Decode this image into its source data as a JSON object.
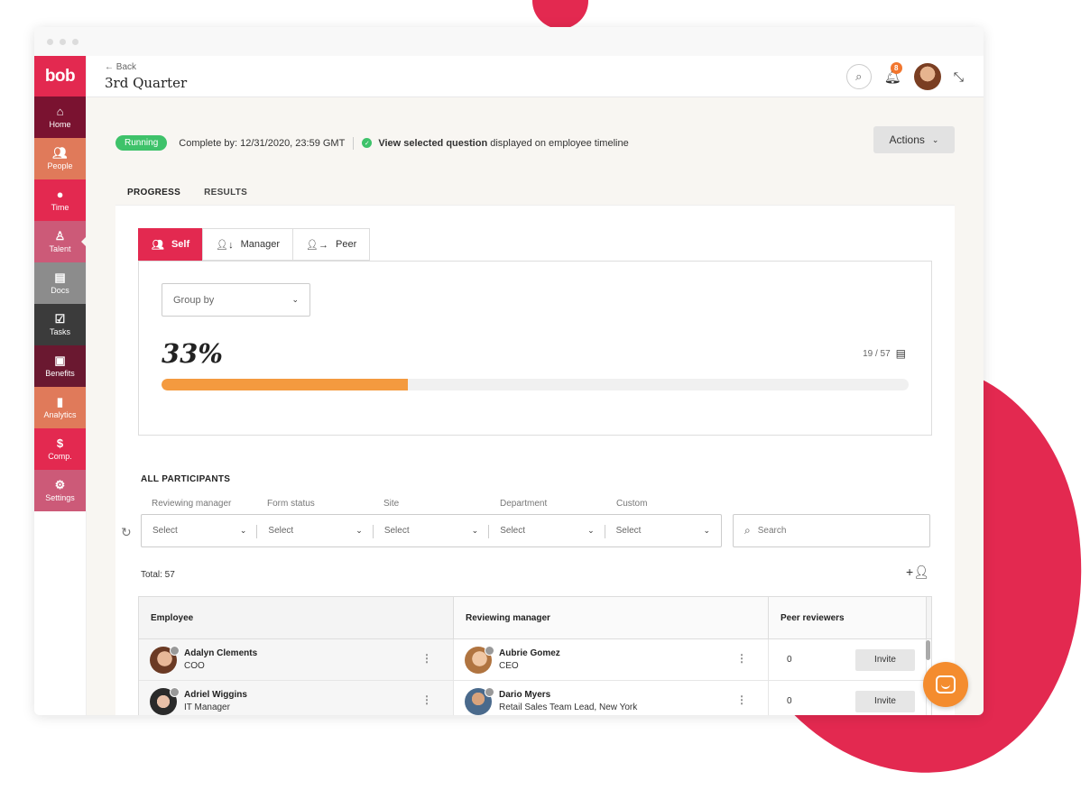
{
  "app": {
    "logo": "bob",
    "brand_color": "#e32950"
  },
  "sidebar": {
    "items": [
      {
        "label": "Home",
        "icon": "home-icon",
        "color": "#7a1230"
      },
      {
        "label": "People",
        "icon": "people-icon",
        "color": "#e07a5a"
      },
      {
        "label": "Time",
        "icon": "clock-icon",
        "color": "#e32950"
      },
      {
        "label": "Talent",
        "icon": "talent-icon",
        "color": "#cc5a78",
        "active": true
      },
      {
        "label": "Docs",
        "icon": "docs-icon",
        "color": "#8c8c8c"
      },
      {
        "label": "Tasks",
        "icon": "tasks-icon",
        "color": "#3b3b3b"
      },
      {
        "label": "Benefits",
        "icon": "gift-icon",
        "color": "#6a1830"
      },
      {
        "label": "Analytics",
        "icon": "analytics-icon",
        "color": "#e07a5a"
      },
      {
        "label": "Comp.",
        "icon": "dollar-icon",
        "color": "#e32950"
      },
      {
        "label": "Settings",
        "icon": "gear-icon",
        "color": "#cc5a78"
      }
    ]
  },
  "header": {
    "back_label": "← Back",
    "title": "3rd Quarter",
    "notification_count": "8"
  },
  "status": {
    "badge": "Running",
    "complete_by": "Complete by: 12/31/2020, 23:59 GMT",
    "view_selected": "View selected question",
    "timeline_text": " displayed on employee timeline",
    "actions_label": "Actions"
  },
  "tabs": [
    "PROGRESS",
    "RESULTS"
  ],
  "subtabs": [
    {
      "label": "Self",
      "icon": "people-icon"
    },
    {
      "label": "Manager",
      "icon": "manager-icon"
    },
    {
      "label": "Peer",
      "icon": "peer-icon"
    }
  ],
  "progress": {
    "group_by_placeholder": "Group by",
    "percent_label": "33%",
    "count_label": "19 / 57",
    "fraction": 0.33
  },
  "participants": {
    "title": "ALL PARTICIPANTS",
    "filters": [
      {
        "label": "Reviewing manager",
        "value": "Select"
      },
      {
        "label": "Form status",
        "value": "Select"
      },
      {
        "label": "Site",
        "value": "Select"
      },
      {
        "label": "Department",
        "value": "Select"
      },
      {
        "label": "Custom",
        "value": "Select"
      }
    ],
    "search_placeholder": "Search",
    "total": "Total: 57",
    "columns": [
      "Employee",
      "Reviewing manager",
      "Peer reviewers"
    ],
    "rows": [
      {
        "employee": "Adalyn Clements",
        "employee_role": "COO",
        "manager": "Aubrie Gomez",
        "manager_role": "CEO",
        "peers": "0",
        "action": "Invite"
      },
      {
        "employee": "Adriel Wiggins",
        "employee_role": "IT Manager",
        "manager": "Dario Myers",
        "manager_role": "Retail Sales Team Lead, New York",
        "peers": "0",
        "action": "Invite"
      }
    ]
  }
}
